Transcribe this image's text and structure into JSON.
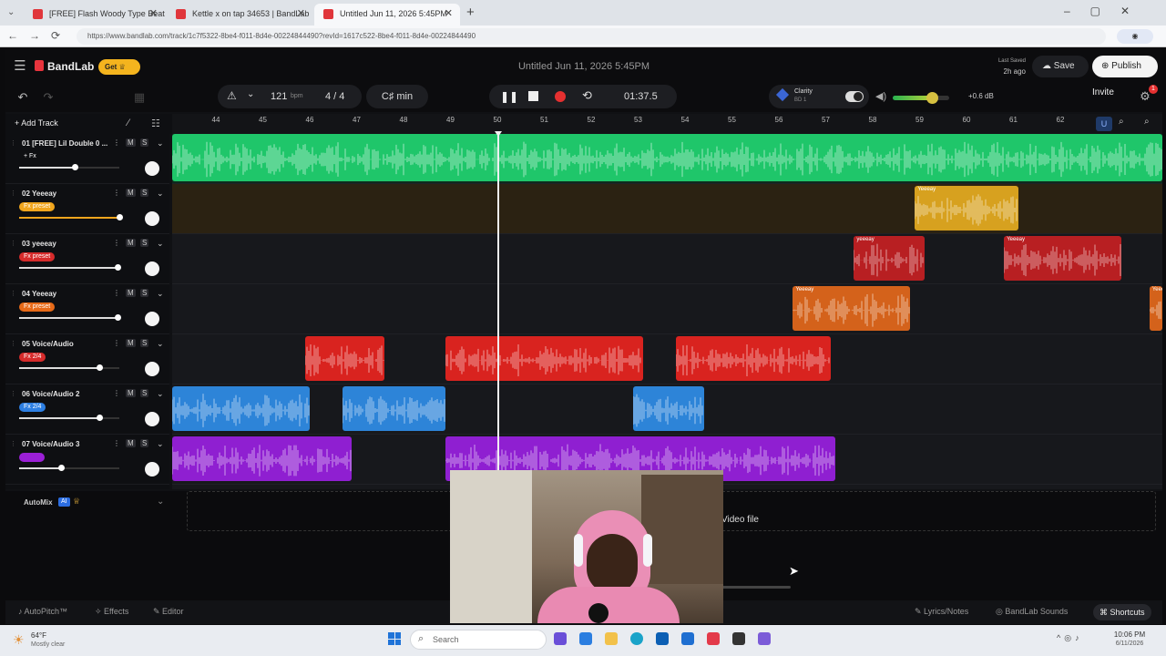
{
  "browser": {
    "tabs": [
      {
        "title": "[FREE] Flash Woody Type Beat - \"",
        "active": false
      },
      {
        "title": "Kettle x on tap 34653 | BandLab",
        "active": false
      },
      {
        "title": "Untitled Jun 11, 2026 5:45PM",
        "active": true
      }
    ],
    "url": "https://www.bandlab.com/track/1c7f5322-8be4-f011-8d4e-00224844490?revId=1617c522-8be4-f011-8d4e-00224844490"
  },
  "header": {
    "brand": "BandLab",
    "get_label": "Get",
    "project_title": "Untitled Jun 11, 2026 5:45PM",
    "last_saved_label": "Last Saved",
    "last_saved_time": "2h ago",
    "save_label": "Save",
    "publish_label": "Publish"
  },
  "toolbar": {
    "tempo": "121",
    "tempo_unit": "bpm",
    "time_signature": "4 / 4",
    "key": "C♯ min",
    "time": "01:37.5",
    "clarity_label": "Clarity",
    "clarity_sub": "BD 1",
    "volume_db": "+0.6 dB",
    "invite_label": "Invite",
    "notification_count": "1",
    "master_volume_fraction": 0.7
  },
  "sidebar": {
    "add_track_label": "Add Track"
  },
  "ruler": {
    "marks": [
      "44",
      "45",
      "46",
      "47",
      "48",
      "49",
      "50",
      "51",
      "52",
      "53",
      "54",
      "55",
      "56",
      "57",
      "58",
      "59",
      "60",
      "61",
      "62"
    ],
    "playhead_bar": 50
  },
  "tracks": [
    {
      "name": "01 [FREE] Lil Double 0 ...",
      "tag": "+ Fx",
      "tag_color": "transparent",
      "lane_bg": "#0e2a1c",
      "volume": 0.55,
      "clips": [
        {
          "start": 43.0,
          "end": 64.5,
          "label": "",
          "color": "#1fc66a"
        }
      ]
    },
    {
      "name": "02 Yeeeay",
      "tag": "Fx preset",
      "tag_color": "#f0a51d",
      "lane_bg": "#2b2212",
      "volume": 1.0,
      "clips": [
        {
          "start": 58.9,
          "end": 61.1,
          "label": "Yeeeay",
          "color": "#d7a11f"
        }
      ]
    },
    {
      "name": "03 yeeeay",
      "tag": "Fx preset",
      "tag_color": "#d62b2b",
      "lane_bg": "#17181c",
      "volume": 0.98,
      "clips": [
        {
          "start": 57.6,
          "end": 59.1,
          "label": "yeeeay",
          "color": "#b81f22"
        },
        {
          "start": 60.8,
          "end": 63.3,
          "label": "Yeeeay",
          "color": "#b81f22"
        }
      ]
    },
    {
      "name": "04 Yeeeay",
      "tag": "Fx preset",
      "tag_color": "#e76a18",
      "lane_bg": "#17181c",
      "volume": 0.98,
      "clips": [
        {
          "start": 56.3,
          "end": 58.8,
          "label": "Yeeeay",
          "color": "#d4621b"
        },
        {
          "start": 63.9,
          "end": 65.8,
          "label": "Yeeeay",
          "color": "#d4621b"
        }
      ]
    },
    {
      "name": "05 Voice/Audio",
      "tag": "Fx 2/4",
      "tag_color": "#d62b2b",
      "lane_bg": "#17181c",
      "volume": 0.8,
      "clips": [
        {
          "start": 45.9,
          "end": 47.6,
          "label": "",
          "color": "#d9231f"
        },
        {
          "start": 48.9,
          "end": 53.1,
          "label": "",
          "color": "#d9231f"
        },
        {
          "start": 53.8,
          "end": 57.1,
          "label": "",
          "color": "#d9231f"
        }
      ]
    },
    {
      "name": "06 Voice/Audio 2",
      "tag": "Fx 2/4",
      "tag_color": "#2d7fe3",
      "lane_bg": "#17181c",
      "volume": 0.8,
      "clips": [
        {
          "start": 43.0,
          "end": 46.0,
          "label": "",
          "color": "#2d84d8"
        },
        {
          "start": 46.7,
          "end": 48.9,
          "label": "",
          "color": "#2d84d8"
        },
        {
          "start": 52.9,
          "end": 54.4,
          "label": "",
          "color": "#2d84d8"
        }
      ]
    },
    {
      "name": "07 Voice/Audio 3",
      "tag": "",
      "tag_color": "#9b1fd6",
      "lane_bg": "#17181c",
      "volume": 0.42,
      "clips": [
        {
          "start": 43.0,
          "end": 46.9,
          "label": "",
          "color": "#8f1fd1"
        },
        {
          "start": 48.9,
          "end": 57.2,
          "label": "",
          "color": "#8f1fd1"
        }
      ]
    }
  ],
  "automix": {
    "label": "AutoMix",
    "badge": "AI",
    "drop_text": "Video file"
  },
  "bottom": {
    "autopitch": "AutoPitch™",
    "effects": "Effects",
    "editor": "Editor",
    "lyrics": "Lyrics/Notes",
    "sounds": "BandLab Sounds",
    "shortcuts": "Shortcuts"
  },
  "taskbar": {
    "weather_temp": "64°F",
    "weather_desc": "Mostly clear",
    "search_placeholder": "Search",
    "clock_time": "10:06 PM",
    "clock_date": "6/11/2026"
  }
}
